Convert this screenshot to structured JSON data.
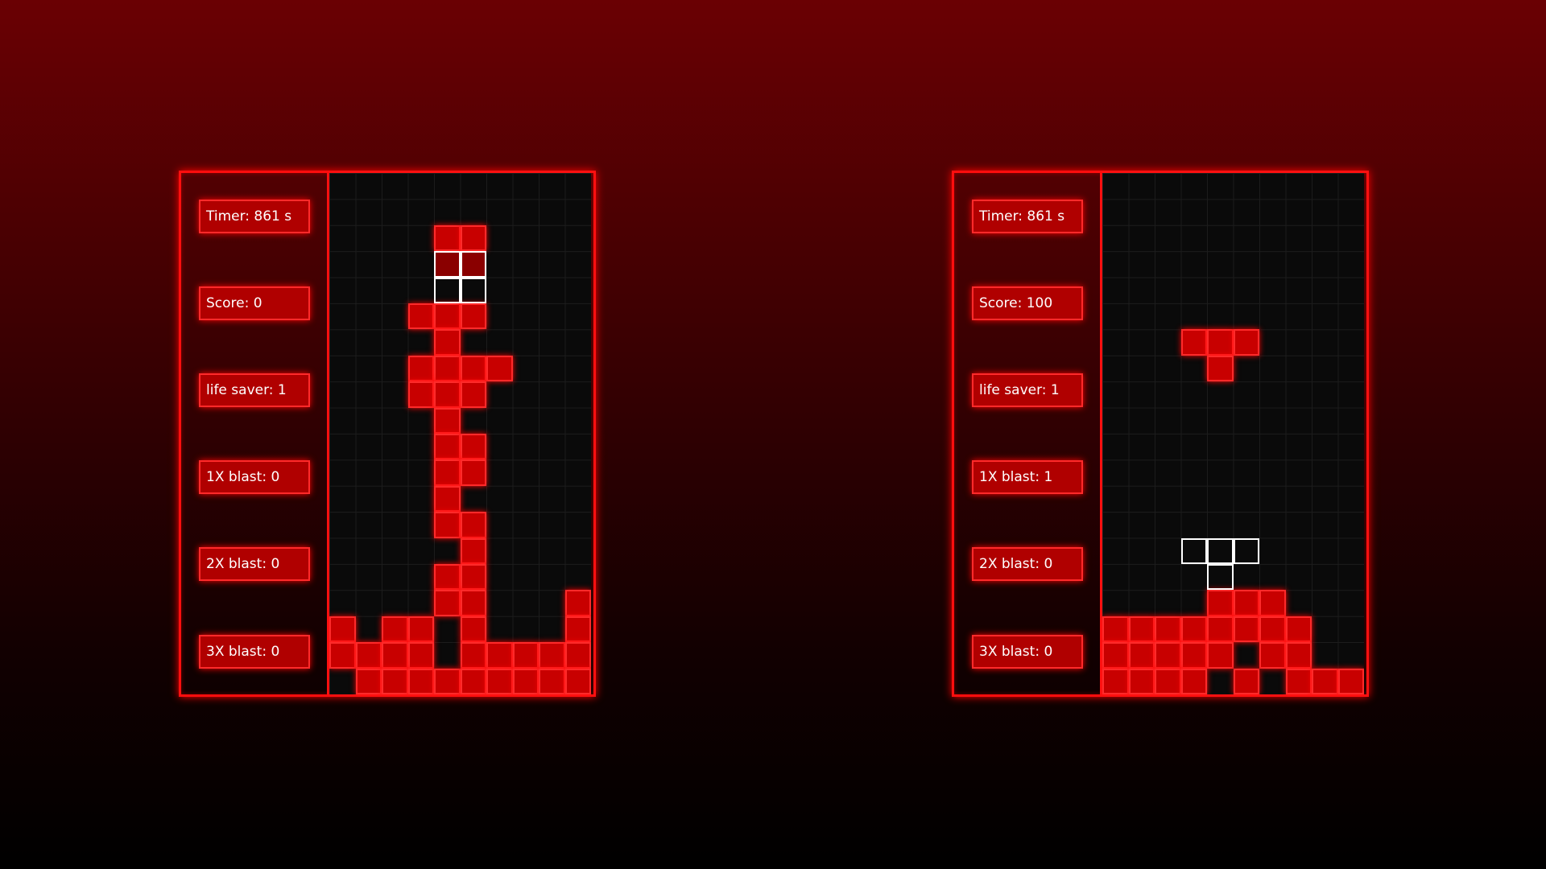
{
  "games": [
    {
      "stats": [
        {
          "label": "Timer: 861 s"
        },
        {
          "label": "Score: 0"
        },
        {
          "label": "life saver: 1"
        },
        {
          "label": "1X blast: 0"
        },
        {
          "label": "2X blast: 0"
        },
        {
          "label": "3X blast: 0"
        }
      ],
      "board": {
        "cols": 10,
        "rows": 20,
        "filled": [
          [
            2,
            4
          ],
          [
            2,
            5
          ],
          [
            5,
            3
          ],
          [
            5,
            4
          ],
          [
            5,
            5
          ],
          [
            6,
            4
          ],
          [
            7,
            3
          ],
          [
            7,
            4
          ],
          [
            7,
            5
          ],
          [
            7,
            6
          ],
          [
            8,
            3
          ],
          [
            8,
            4
          ],
          [
            8,
            5
          ],
          [
            9,
            4
          ],
          [
            10,
            4
          ],
          [
            10,
            5
          ],
          [
            11,
            4
          ],
          [
            11,
            5
          ],
          [
            12,
            4
          ],
          [
            13,
            4
          ],
          [
            13,
            5
          ],
          [
            14,
            5
          ],
          [
            15,
            4
          ],
          [
            15,
            5
          ],
          [
            16,
            4
          ],
          [
            16,
            5
          ],
          [
            16,
            9
          ],
          [
            17,
            0
          ],
          [
            17,
            2
          ],
          [
            17,
            3
          ],
          [
            17,
            5
          ],
          [
            17,
            9
          ],
          [
            18,
            0
          ],
          [
            18,
            1
          ],
          [
            18,
            2
          ],
          [
            18,
            3
          ],
          [
            18,
            5
          ],
          [
            18,
            6
          ],
          [
            18,
            7
          ],
          [
            18,
            8
          ],
          [
            18,
            9
          ],
          [
            19,
            1
          ],
          [
            19,
            2
          ],
          [
            19,
            3
          ],
          [
            19,
            4
          ],
          [
            19,
            5
          ],
          [
            19,
            6
          ],
          [
            19,
            7
          ],
          [
            19,
            8
          ],
          [
            19,
            9
          ]
        ],
        "ghost": [
          [
            3,
            4
          ],
          [
            3,
            5
          ],
          [
            4,
            4
          ],
          [
            4,
            5
          ]
        ],
        "ghost_fill": [
          [
            3,
            4
          ],
          [
            3,
            5
          ]
        ]
      }
    },
    {
      "stats": [
        {
          "label": "Timer: 861 s"
        },
        {
          "label": "Score: 100"
        },
        {
          "label": "life saver: 1"
        },
        {
          "label": "1X blast: 1"
        },
        {
          "label": "2X blast: 0"
        },
        {
          "label": "3X blast: 0"
        }
      ],
      "board": {
        "cols": 10,
        "rows": 20,
        "filled": [
          [
            6,
            3
          ],
          [
            6,
            4
          ],
          [
            6,
            5
          ],
          [
            7,
            4
          ],
          [
            16,
            4
          ],
          [
            16,
            5
          ],
          [
            16,
            6
          ],
          [
            17,
            0
          ],
          [
            17,
            1
          ],
          [
            17,
            2
          ],
          [
            17,
            3
          ],
          [
            17,
            4
          ],
          [
            17,
            5
          ],
          [
            17,
            6
          ],
          [
            17,
            7
          ],
          [
            18,
            0
          ],
          [
            18,
            1
          ],
          [
            18,
            2
          ],
          [
            18,
            3
          ],
          [
            18,
            4
          ],
          [
            18,
            6
          ],
          [
            18,
            7
          ],
          [
            19,
            0
          ],
          [
            19,
            1
          ],
          [
            19,
            2
          ],
          [
            19,
            3
          ],
          [
            19,
            5
          ],
          [
            19,
            7
          ],
          [
            19,
            8
          ],
          [
            19,
            9
          ]
        ],
        "ghost": [
          [
            14,
            3
          ],
          [
            14,
            4
          ],
          [
            14,
            5
          ],
          [
            15,
            4
          ]
        ],
        "ghost_fill": []
      }
    }
  ],
  "colors": {
    "block": "#c80000",
    "block_border": "#ff2a2a",
    "ghost_border": "#ffffff",
    "board_bg": "#0a0a0a"
  }
}
